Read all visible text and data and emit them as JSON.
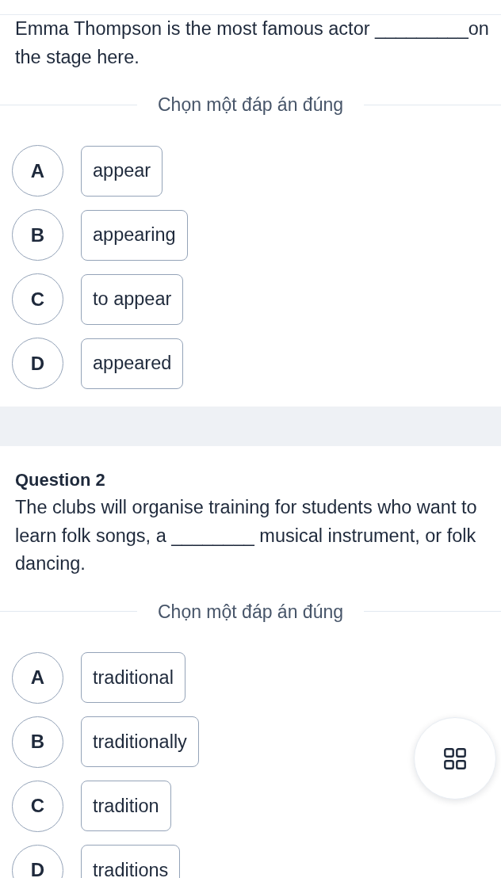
{
  "questions": [
    {
      "text": "Emma Thompson is the most famous actor _________on the stage here.",
      "prompt": "Chọn một đáp án đúng",
      "options": [
        {
          "letter": "A",
          "text": "appear",
          "selected": false
        },
        {
          "letter": "B",
          "text": "appearing",
          "selected": false
        },
        {
          "letter": "C",
          "text": "to appear",
          "selected": false
        },
        {
          "letter": "D",
          "text": "appeared",
          "selected": false
        }
      ]
    },
    {
      "title": "Question 2",
      "text": "The clubs will organise training for students who want to learn folk songs, a ________ musical instrument, or folk dancing.",
      "prompt": "Chọn một đáp án đúng",
      "options": [
        {
          "letter": "A",
          "text": "traditional",
          "selected": false
        },
        {
          "letter": "B",
          "text": "traditionally",
          "selected": false
        },
        {
          "letter": "C",
          "text": "tradition",
          "selected": false
        },
        {
          "letter": "D",
          "text": "traditions",
          "selected": false
        }
      ]
    }
  ]
}
